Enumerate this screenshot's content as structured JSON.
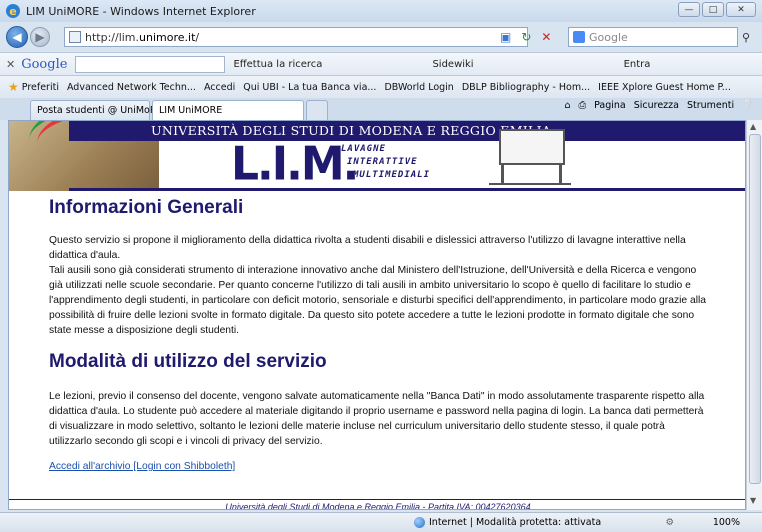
{
  "window": {
    "title": "LIM UniMORE - Windows Internet Explorer"
  },
  "address": {
    "url_prefix": "http://lim.",
    "url_domain": "unimore.it",
    "url_suffix": "/"
  },
  "search": {
    "placeholder": "Google"
  },
  "google_toolbar": {
    "logo": "Google",
    "items": [
      "Effettua la ricerca",
      "Sidewiki",
      "Entra"
    ]
  },
  "favorites": {
    "label": "Preferiti",
    "items": [
      "Advanced Network Techn...",
      "Accedi",
      "Qui UBI - La tua Banca via...",
      "DBWorld Login",
      "DBLP Bibliography - Hom...",
      "IEEE Xplore Guest Home P..."
    ]
  },
  "tabs": [
    {
      "label": "Posta studenti @ UniMoRe..."
    },
    {
      "label": "LIM UniMORE"
    }
  ],
  "command_bar": {
    "items": [
      "Pagina",
      "Sicurezza",
      "Strumenti"
    ]
  },
  "banner": {
    "university": "UNIVERSITÀ DEGLI STUDI DI MODENA E REGGIO EMILIA",
    "acronym": "L.I.M.",
    "line1": "LAVAGNE",
    "line2": "INTERATTIVE",
    "line3": "MULTIMEDIALI"
  },
  "content": {
    "heading1": "Informazioni Generali",
    "para1": "Questo servizio si propone il miglioramento della didattica rivolta a studenti disabili e dislessici attraverso l'utilizzo di lavagne interattive nella didattica d'aula.",
    "para2": "Tali ausili sono già considerati strumento di interazione innovativo anche dal Ministero dell'Istruzione, dell'Università e della Ricerca e vengono già utilizzati nelle scuole secondarie. Per quanto concerne l'utilizzo di tali ausili in ambito universitario lo scopo è quello di facilitare lo studio e l'apprendimento degli studenti, in particolare con deficit motorio, sensoriale e disturbi specifici dell'apprendimento, in particolare modo grazie alla possibilità di fruire delle lezioni svolte in formato digitale. Da questo sito potete accedere a tutte le lezioni prodotte in formato digitale che sono state messe a disposizione degli studenti.",
    "heading2": "Modalità di utilizzo del servizio",
    "para3": "Le lezioni, previo il consenso del docente, vengono salvate automaticamente nella \"Banca Dati\" in modo assolutamente trasparente rispetto alla didattica d'aula. Lo studente può accedere al materiale digitando il proprio username e password nella pagina di login. La banca dati permetterà di visualizzare in modo selettivo, soltanto le lezioni delle materie incluse nel curriculum universitario dello studente stesso, il quale potrà utilizzarlo secondo gli scopi e i vincoli di privacy del servizio.",
    "link": "Accedi all'archivio [Login con Shibboleth]",
    "footer": "Università degli Studi di Modena e Reggio Emilia - Partita IVA: 00427620364"
  },
  "status": {
    "text": "Internet | Modalità protetta: attivata",
    "zoom": "100%"
  }
}
